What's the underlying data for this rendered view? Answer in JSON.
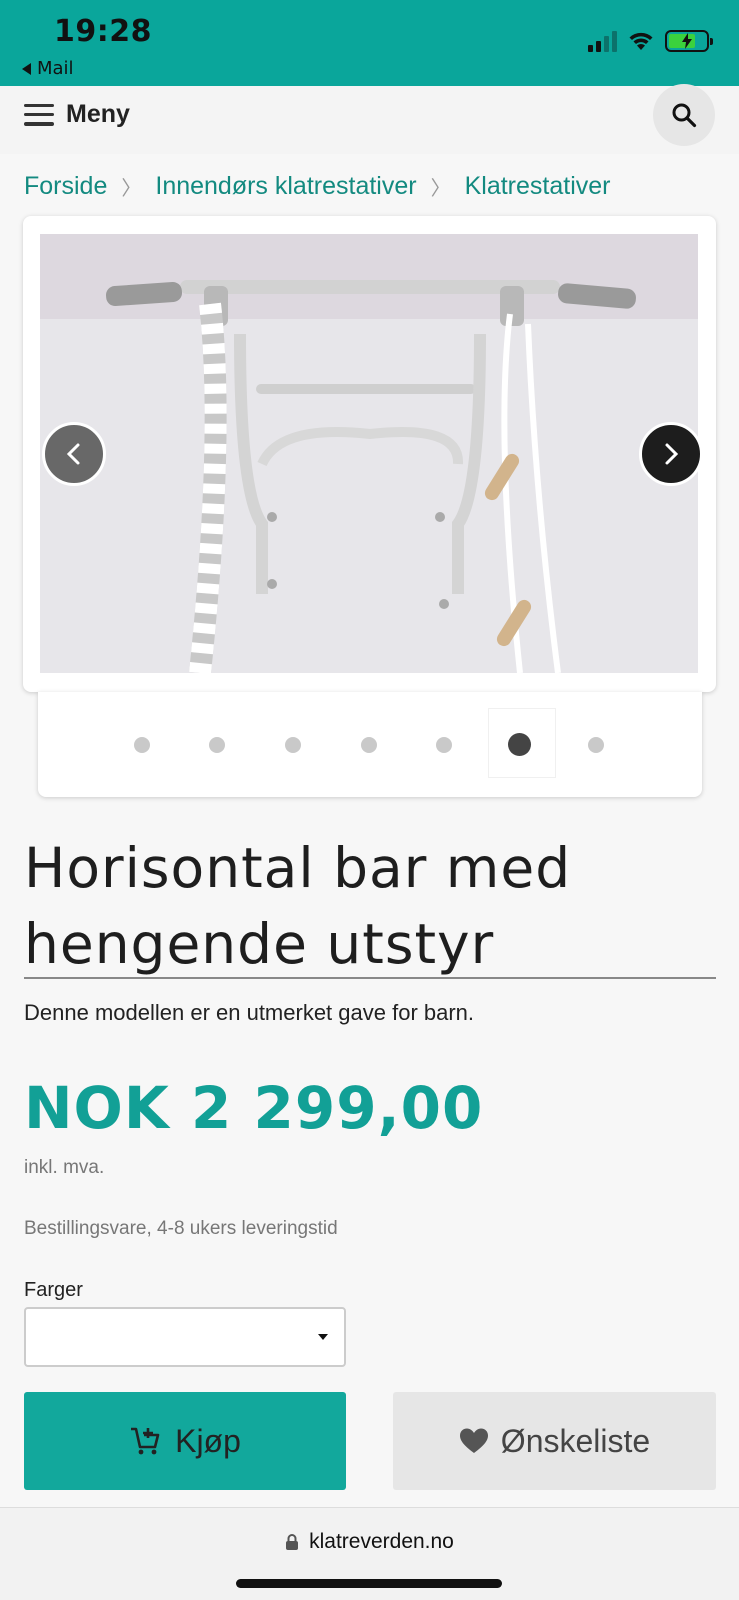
{
  "status_bar": {
    "time": "19:28",
    "back_app": "Mail",
    "battery_color": "#3bd23d"
  },
  "header": {
    "menu_label": "Meny"
  },
  "breadcrumb": {
    "items": [
      "Forside",
      "Innendørs klatrestativer",
      "Klatrestativer"
    ]
  },
  "gallery": {
    "total_images": 7,
    "active_index": 6
  },
  "product": {
    "title_line1": "Horisontal bar med",
    "title_line2": "hengende utstyr",
    "description": "Denne modellen er en utmerket gave for barn.",
    "price": "NOK 2 299,00",
    "vat_note": "inkl. mva.",
    "delivery": "Bestillingsvare, 4-8 ukers leveringstid",
    "color_label": "Farger",
    "color_value": ""
  },
  "actions": {
    "buy_label": "Kjøp",
    "wishlist_label": "Ønskeliste"
  },
  "browser": {
    "url": "klatreverden.no"
  },
  "colors": {
    "brand": "#12a89c",
    "status_bar": "#0aa69b"
  }
}
